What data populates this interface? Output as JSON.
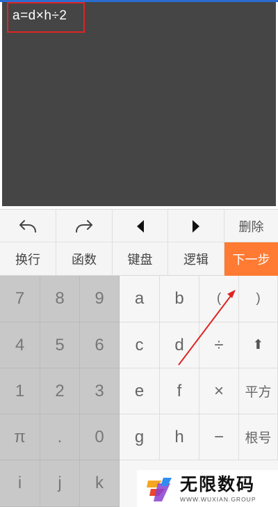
{
  "editor": {
    "formula": "a=d×h÷2"
  },
  "toolbar": {
    "undo_icon": "undo-icon",
    "redo_icon": "redo-icon",
    "left_icon": "cursor-left-icon",
    "right_icon": "cursor-right-icon",
    "delete_label": "删除"
  },
  "modes": {
    "newline": "换行",
    "function": "函数",
    "keyboard": "键盘",
    "logic": "逻辑",
    "next_step": "下一步",
    "next_color": "#ff7a32"
  },
  "keys": {
    "row1": [
      "7",
      "8",
      "9",
      "a",
      "b",
      "(",
      ")"
    ],
    "row2": [
      "4",
      "5",
      "6",
      "c",
      "d",
      "÷",
      "⬆"
    ],
    "row3": [
      "1",
      "2",
      "3",
      "e",
      "f",
      "×",
      "平方"
    ],
    "row4": [
      "π",
      ".",
      "0",
      "g",
      "h",
      "−",
      "根号"
    ],
    "row5": [
      "i",
      "j",
      "k"
    ]
  },
  "watermark": {
    "name": "无限数码",
    "url": "WWW.WUXIAN.GROUP"
  }
}
